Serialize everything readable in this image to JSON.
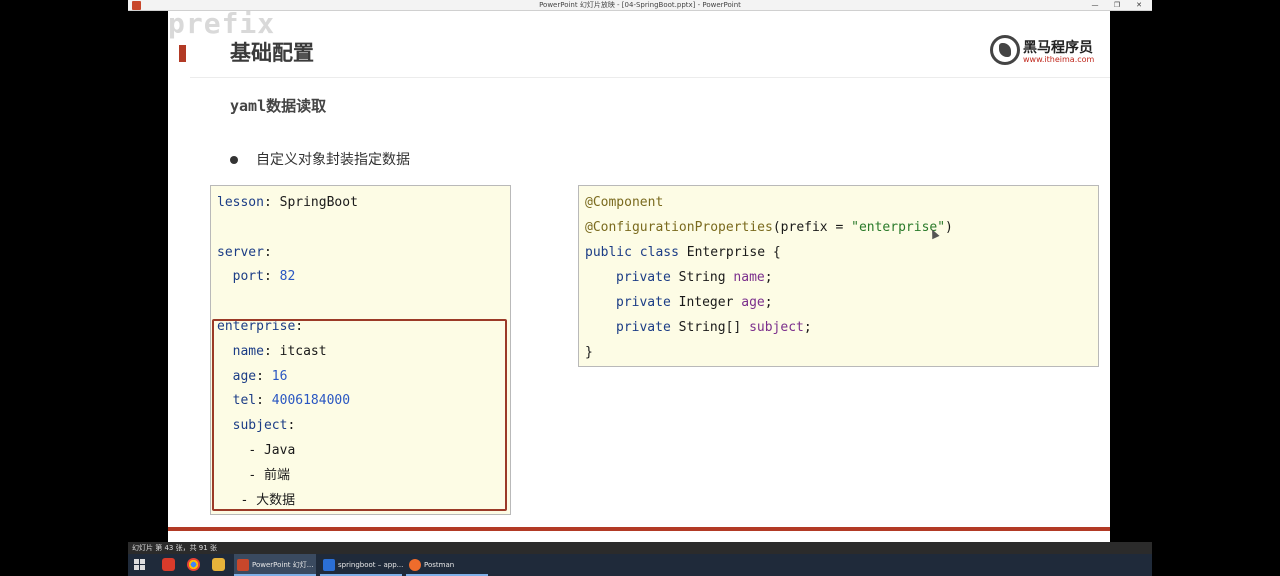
{
  "window": {
    "title": "PowerPoint 幻灯片放映 - [04-SpringBoot.pptx] - PowerPoint",
    "min_icon": "minimize-icon",
    "max_icon": "restore-icon",
    "close_icon": "close-icon"
  },
  "slide": {
    "watermark": "prefix",
    "title": "基础配置",
    "subtitle": "yaml数据读取",
    "bullet": "自定义对象封装指定数据",
    "logo": {
      "name": "黑马程序员",
      "url": "www.itheima.com"
    },
    "yaml_lines": [
      {
        "key": "lesson",
        "sep": ": ",
        "value": "SpringBoot"
      },
      {
        "key": "",
        "sep": "",
        "value": ""
      },
      {
        "key": "server",
        "sep": ":",
        "value": ""
      },
      {
        "indent": "  ",
        "key": "port",
        "sep": ": ",
        "value": "82"
      },
      {
        "key": "",
        "sep": "",
        "value": ""
      },
      {
        "key": "enterprise",
        "sep": ":",
        "value": ""
      },
      {
        "indent": "  ",
        "key": "name",
        "sep": ": ",
        "value": "itcast"
      },
      {
        "indent": "  ",
        "key": "age",
        "sep": ": ",
        "value": "16"
      },
      {
        "indent": "  ",
        "key": "tel",
        "sep": ": ",
        "value": "4006184000"
      },
      {
        "indent": "  ",
        "key": "subject",
        "sep": ":",
        "value": ""
      },
      {
        "indent": "    ",
        "key": "",
        "sep": "",
        "value": "- Java"
      },
      {
        "indent": "    ",
        "key": "",
        "sep": "",
        "value": "- 前端"
      },
      {
        "indent": "   ",
        "key": "",
        "sep": "",
        "value": "- 大数据"
      }
    ],
    "java": {
      "annotation1": "@Component",
      "annotation2": "@ConfigurationProperties",
      "annotation2_args_open": "(prefix = ",
      "annotation2_string": "\"enterprise\"",
      "annotation2_args_close": ")",
      "class_decl_kw": "public class",
      "class_decl_rest": " Enterprise {",
      "fields": [
        {
          "mod": "private",
          "type": " String ",
          "name": "name",
          "end": ";"
        },
        {
          "mod": "private",
          "type": " Integer ",
          "name": "age",
          "end": ";"
        },
        {
          "mod": "private",
          "type": " String[] ",
          "name": "subject",
          "end": ";"
        }
      ],
      "close": "}"
    }
  },
  "statusbar": {
    "text": "幻灯片 第 43 张，共 91 张"
  },
  "taskbar": {
    "items": [
      {
        "label": "PowerPoint 幻灯...",
        "color": "#c8472b"
      },
      {
        "label": "springboot – app...",
        "color": "#2b6fd6"
      },
      {
        "label": "Postman",
        "color": "#ef6c2c"
      }
    ]
  }
}
